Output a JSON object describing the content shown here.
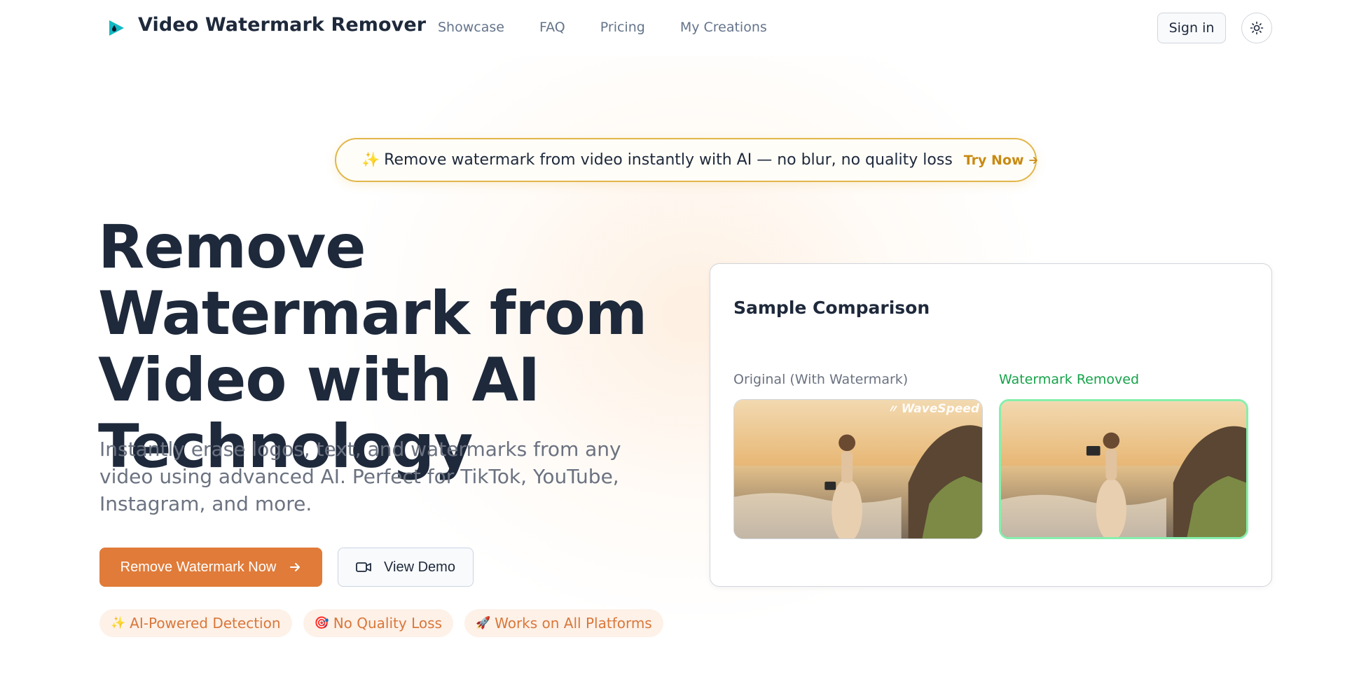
{
  "header": {
    "brand": "Video Watermark Remover",
    "logo_icon": "play-droplet-icon",
    "nav": [
      "Showcase",
      "FAQ",
      "Pricing",
      "My Creations"
    ],
    "sign_in": "Sign in",
    "theme_icon": "sun-icon"
  },
  "announcement": {
    "icon": "trophy-icon",
    "sparkle": "✨",
    "message": "Remove watermark from video instantly with AI — no blur, no quality loss",
    "cta": "Try Now"
  },
  "hero": {
    "title": "Remove Watermark from Video with AI Technology",
    "subtitle": "Instantly erase logos, text, and watermarks from any video using advanced AI. Perfect for TikTok, YouTube, Instagram, and more.",
    "primary_button": "Remove Watermark Now",
    "secondary_button": "View Demo",
    "features": [
      {
        "emoji": "✨",
        "label": "AI-Powered Detection"
      },
      {
        "emoji": "🎯",
        "label": "No Quality Loss"
      },
      {
        "emoji": "🚀",
        "label": "Works on All Platforms"
      }
    ]
  },
  "comparison": {
    "title": "Sample Comparison",
    "original_label": "Original (With Watermark)",
    "clean_label": "Watermark Removed",
    "watermark_text": "WaveSpeed"
  },
  "colors": {
    "primary": "#e07b39",
    "text_dark": "#1e293b",
    "muted": "#6b7280",
    "accent_gold": "#e2b64a",
    "success": "#16a34a"
  }
}
